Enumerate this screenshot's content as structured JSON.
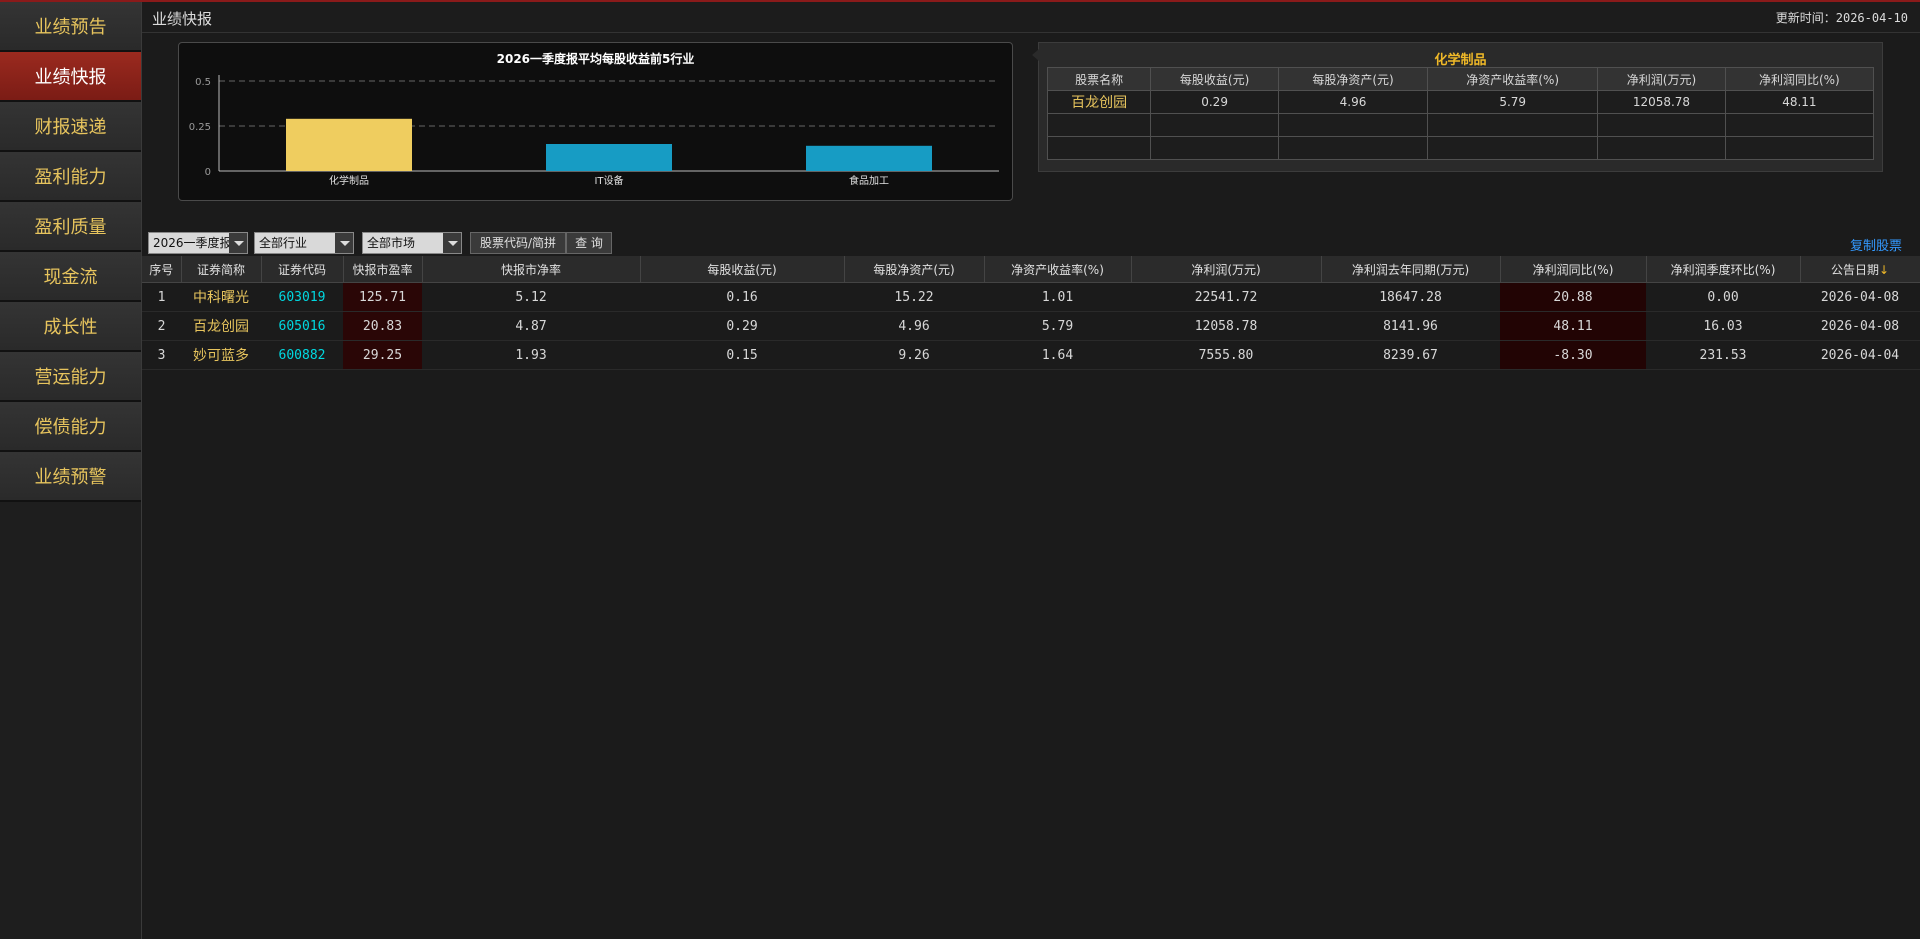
{
  "sidebar": {
    "items": [
      {
        "label": "业绩预告"
      },
      {
        "label": "业绩快报"
      },
      {
        "label": "财报速递"
      },
      {
        "label": "盈利能力"
      },
      {
        "label": "盈利质量"
      },
      {
        "label": "现金流"
      },
      {
        "label": "成长性"
      },
      {
        "label": "营运能力"
      },
      {
        "label": "偿债能力"
      },
      {
        "label": "业绩预警"
      }
    ],
    "active_index": 1
  },
  "header": {
    "title": "业绩快报",
    "update_label": "更新时间：2026-04-10"
  },
  "chart_data": {
    "type": "bar",
    "title": "2026一季度报平均每股收益前5行业",
    "categories": [
      "化学制品",
      "IT设备",
      "食品加工"
    ],
    "values": [
      0.29,
      0.15,
      0.14
    ],
    "colors": [
      "#efcd5f",
      "#179cc4",
      "#179cc4"
    ],
    "ylim": [
      0,
      0.5
    ],
    "yticks": [
      0,
      0.25,
      0.5
    ],
    "ytick_labels": [
      "0",
      "0.25",
      "0.5"
    ],
    "grid": true,
    "xlabel": "",
    "ylabel": ""
  },
  "summary": {
    "title": "化学制品",
    "columns": [
      "股票名称",
      "每股收益(元)",
      "每股净资产(元)",
      "净资产收益率(%)",
      "净利润(万元)",
      "净利润同比(%)"
    ],
    "rows": [
      [
        "百龙创园",
        "0.29",
        "4.96",
        "5.79",
        "12058.78",
        "48.11"
      ],
      [
        "",
        "",
        "",
        "",
        "",
        ""
      ],
      [
        "",
        "",
        "",
        "",
        "",
        ""
      ]
    ]
  },
  "filters": {
    "period": "2026一季度报",
    "industry": "全部行业",
    "market": "全部市场",
    "search_button": "股票代码/简拼",
    "query_button": "查 询",
    "copy_link": "复制股票"
  },
  "table": {
    "columns": [
      "序号",
      "证券简称",
      "证券代码",
      "快报市盈率",
      "快报市净率",
      "每股收益(元)",
      "每股净资产(元)",
      "净资产收益率(%)",
      "净利润(万元)",
      "净利润去年同期(万元)",
      "净利润同比(%)",
      "净利润季度环比(%)",
      "公告日期"
    ],
    "sort_indicator": "↓",
    "rows": [
      {
        "idx": "1",
        "name": "中科曙光",
        "code": "603019",
        "pe": "125.71",
        "pb": "5.12",
        "eps": "0.16",
        "bps": "15.22",
        "roe": "1.01",
        "profit": "22541.72",
        "profit_ly": "18647.28",
        "yoy": "20.88",
        "qoq": "0.00",
        "date": "2026-04-08"
      },
      {
        "idx": "2",
        "name": "百龙创园",
        "code": "605016",
        "pe": "20.83",
        "pb": "4.87",
        "eps": "0.29",
        "bps": "4.96",
        "roe": "5.79",
        "profit": "12058.78",
        "profit_ly": "8141.96",
        "yoy": "48.11",
        "qoq": "16.03",
        "date": "2026-04-08"
      },
      {
        "idx": "3",
        "name": "妙可蓝多",
        "code": "600882",
        "pe": "29.25",
        "pb": "1.93",
        "eps": "0.15",
        "bps": "9.26",
        "roe": "1.64",
        "profit": "7555.80",
        "profit_ly": "8239.67",
        "yoy": "-8.30",
        "qoq": "231.53",
        "date": "2026-04-04"
      }
    ]
  }
}
